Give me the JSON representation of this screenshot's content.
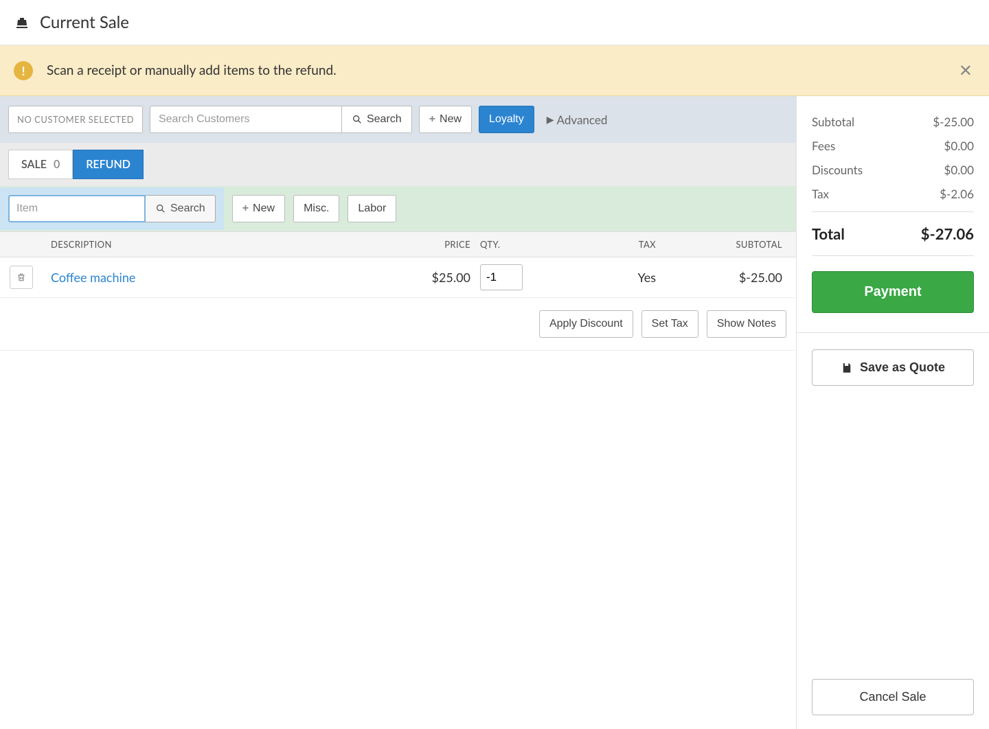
{
  "header": {
    "title": "Current Sale"
  },
  "alert": {
    "text": "Scan a receipt or manually add items to the refund."
  },
  "customerBar": {
    "noCustomer": "NO CUSTOMER SELECTED",
    "searchPlaceholder": "Search Customers",
    "searchBtn": "Search",
    "newBtn": "New",
    "loyaltyBtn": "Loyalty",
    "advanced": "Advanced"
  },
  "tabs": {
    "sale": "SALE",
    "saleCount": "0",
    "refund": "REFUND"
  },
  "itemBar": {
    "itemPlaceholder": "Item",
    "searchBtn": "Search",
    "newBtn": "New",
    "miscBtn": "Misc.",
    "laborBtn": "Labor"
  },
  "columns": {
    "description": "DESCRIPTION",
    "price": "PRICE",
    "qty": "QTY.",
    "tax": "TAX",
    "subtotal": "SUBTOTAL"
  },
  "lines": [
    {
      "description": "Coffee machine",
      "price": "$25.00",
      "qty": "-1",
      "tax": "Yes",
      "subtotal": "$-25.00"
    }
  ],
  "actions": {
    "applyDiscount": "Apply Discount",
    "setTax": "Set Tax",
    "showNotes": "Show Notes"
  },
  "summary": {
    "subtotalLabel": "Subtotal",
    "subtotal": "$-25.00",
    "feesLabel": "Fees",
    "fees": "$0.00",
    "discountsLabel": "Discounts",
    "discounts": "$0.00",
    "taxLabel": "Tax",
    "tax": "$-2.06",
    "totalLabel": "Total",
    "total": "$-27.06"
  },
  "buttons": {
    "payment": "Payment",
    "saveQuote": "Save as Quote",
    "cancel": "Cancel Sale"
  }
}
